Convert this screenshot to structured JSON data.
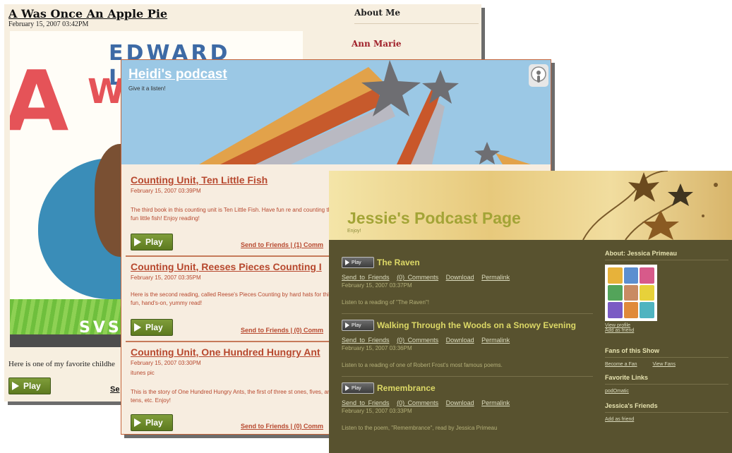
{
  "w1": {
    "post_title": "A Was Once An Apple Pie",
    "post_date": "February 15, 2007 03:42PM",
    "cover_author": "EDWARD LEAR",
    "cover_big_letter": "A",
    "cover_wa": "WA",
    "cover_illustrator": "SVSE",
    "body_text": "Here is one of my favorite childhe",
    "play_label": "Play",
    "send_link": "Se",
    "about_heading": "About Me",
    "about_name": "Ann Marie"
  },
  "w2": {
    "title": "Heidi's podcast",
    "tagline": "Give it a listen!",
    "episodes": [
      {
        "title": "Counting Unit, Ten Little Fish",
        "date": "February 15, 2007 03:39PM",
        "description": "The third book in this counting unit is Ten Little Fish. Have fun re and counting the fun little fish! Enjoy reading!",
        "links": "Send to Friends | (1) Comm",
        "play": "Play"
      },
      {
        "title": "Counting Unit, Reeses Pieces Counting I",
        "date": "February 15, 2007 03:35PM",
        "description": "Here is the second reading, called Reese's Pieces Counting by hard hats for this fun, hand's-on, yummy read!",
        "links": "Send to Friends | (0) Comm",
        "play": "Play"
      },
      {
        "title": "Counting Unit, One Hundred Hungry Ant",
        "date": "February 15, 2007 03:30PM",
        "subtitle": "itunes pic",
        "description": "This is the story of One Hundred Hungry Ants, the first of three st ones, fives, and tens, etc. Enjoy!",
        "links": "Send to Friends | (0) Comm",
        "play": "Play"
      }
    ]
  },
  "w3": {
    "title": "Jessie's Podcast Page",
    "tagline": "Enjoy!",
    "play_label": "Play",
    "episodes": [
      {
        "title": "The Raven",
        "links": [
          "Send to Friends",
          "(0) Comments",
          "Download",
          "Permalink"
        ],
        "date": "February 15, 2007 03:37PM",
        "description": "Listen to a reading of \"The Raven\"!"
      },
      {
        "title": "Walking Through the Woods on a Snowy Evening",
        "links": [
          "Send to Friends",
          "(0) Comments",
          "Download",
          "Permalink"
        ],
        "date": "February 15, 2007 03:36PM",
        "description": "Listen to a reading of one of Robert Frost's most famous poems."
      },
      {
        "title": "Remembrance",
        "links": [
          "Send to Friends",
          "(0) Comments",
          "Download",
          "Permalink"
        ],
        "date": "February 15, 2007 03:33PM",
        "description": "Listen to the poem, \"Remembrance\", read by Jessica Primeau"
      }
    ],
    "sidebar": {
      "about_heading": "About: Jessica Primeau",
      "view_profile": "View profile",
      "add_friend": "Add as friend",
      "fans_heading": "Fans of this Show",
      "become_fan": "Become a Fan",
      "view_fans": "View Fans",
      "fav_heading": "Favorite Links",
      "fav_link": "podOmatic",
      "friends_heading": "Jessica's Friends",
      "friends_add": "Add as friend"
    }
  }
}
